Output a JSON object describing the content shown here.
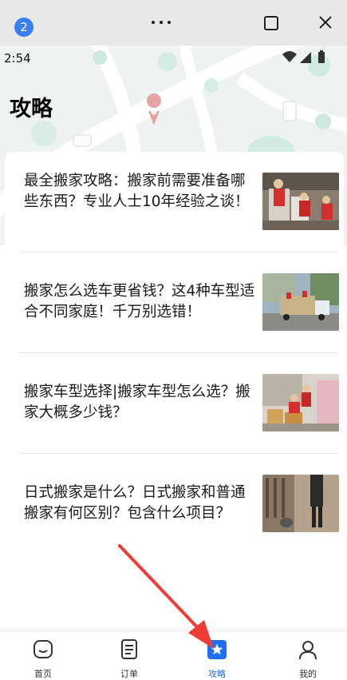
{
  "window": {
    "badge": "2"
  },
  "status": {
    "time": "2:54"
  },
  "page": {
    "title": "攻略"
  },
  "articles": [
    {
      "title": "最全搬家攻略：搬家前需要准备哪些东西？专业人士10年经验之谈！"
    },
    {
      "title": "搬家怎么选车更省钱？这4种车型适合不同家庭！千万别选错！"
    },
    {
      "title": "搬家车型选择|搬家车型怎么选？搬家大概多少钱？"
    },
    {
      "title": "日式搬家是什么？日式搬家和普通搬家有何区别？包含什么项目？"
    }
  ],
  "tabs": [
    {
      "label": "首页",
      "icon": "home-icon"
    },
    {
      "label": "订单",
      "icon": "order-icon"
    },
    {
      "label": "攻略",
      "icon": "star-icon",
      "active": true
    },
    {
      "label": "我的",
      "icon": "user-icon"
    }
  ],
  "colors": {
    "accent": "#1e6ff5",
    "arrow": "#ef3b36"
  }
}
